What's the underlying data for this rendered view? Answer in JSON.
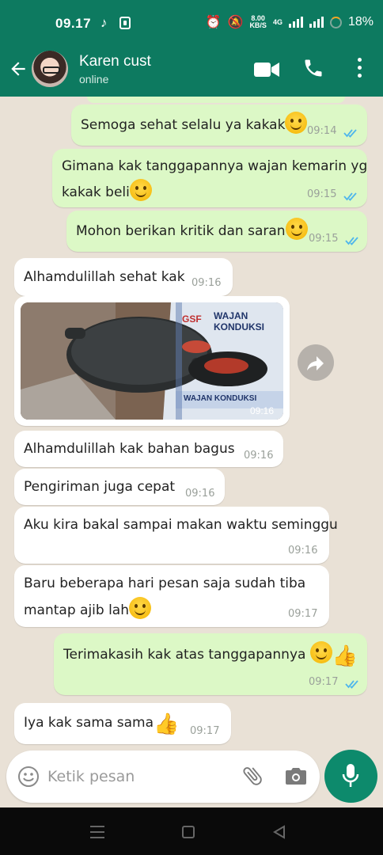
{
  "status_bar": {
    "time": "09.17",
    "speed_value": "8.00",
    "speed_unit": "KB/S",
    "network": "4G",
    "battery": "18%"
  },
  "header": {
    "contact_name": "Karen cust",
    "contact_status": "online"
  },
  "messages": [
    {
      "dir": "out",
      "text": "Semoga sehat selalu ya kakak",
      "emoji": "smile",
      "time": "09:14"
    },
    {
      "dir": "out",
      "lines": [
        "Gimana kak tanggapannya wajan kemarin yg",
        "kakak beli"
      ],
      "emoji": "smile",
      "time": "09:15"
    },
    {
      "dir": "out",
      "text": "Mohon berikan kritik dan saran",
      "emoji": "smile",
      "time": "09:15"
    },
    {
      "dir": "in",
      "text": "Alhamdulillah sehat kak",
      "time": "09:16"
    },
    {
      "dir": "in",
      "type": "image",
      "box_brand": "GSF",
      "box_title": "WAJAN KONDUKSI",
      "box_title_bottom": "WAJAN KONDUKSI",
      "time": "09:16"
    },
    {
      "dir": "in",
      "text": "Alhamdulillah kak bahan bagus",
      "time": "09:16"
    },
    {
      "dir": "in",
      "text": "Pengiriman juga cepat",
      "time": "09:16"
    },
    {
      "dir": "in",
      "text": "Aku kira bakal sampai makan waktu seminggu",
      "time": "09:16"
    },
    {
      "dir": "in",
      "lines": [
        "Baru beberapa hari pesan saja sudah tiba",
        "mantap ajib lah"
      ],
      "emoji": "smile",
      "time": "09:17"
    },
    {
      "dir": "out",
      "text": "Terimakasih kak atas tanggapannya",
      "emoji": "smile+thumbsup",
      "time": "09:17"
    },
    {
      "dir": "in",
      "text": "Iya kak sama sama",
      "emoji": "thumbsup",
      "time": "09:17"
    }
  ],
  "input": {
    "placeholder": "Ketik pesan"
  },
  "colors": {
    "header": "#0d7a60",
    "outgoing": "#dcf8c6",
    "incoming": "#ffffff",
    "read_check": "#4fb6ec",
    "wallpaper": "#e9e1d6"
  },
  "icons": [
    "back-arrow-icon",
    "video-call-icon",
    "phone-icon",
    "more-vert-icon",
    "forward-icon",
    "smiley-icon",
    "attach-icon",
    "camera-icon",
    "mic-icon"
  ]
}
